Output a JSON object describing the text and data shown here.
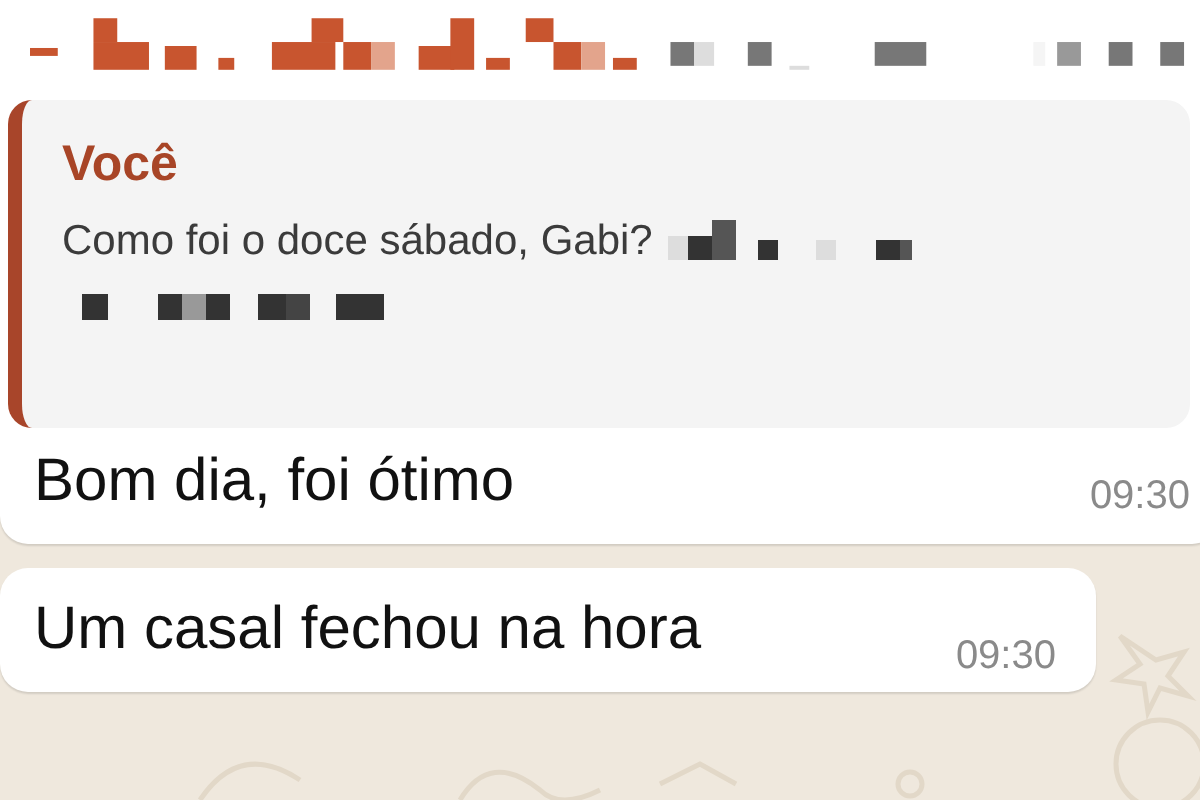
{
  "messages": [
    {
      "kind": "reply",
      "quote": {
        "author": "Você",
        "text": "Como foi o doce sábado, Gabi?"
      },
      "text": "Bom dia, foi ótimo",
      "time": "09:30"
    },
    {
      "kind": "plain",
      "text": "Um casal fechou na hora",
      "time": "09:30"
    }
  ]
}
